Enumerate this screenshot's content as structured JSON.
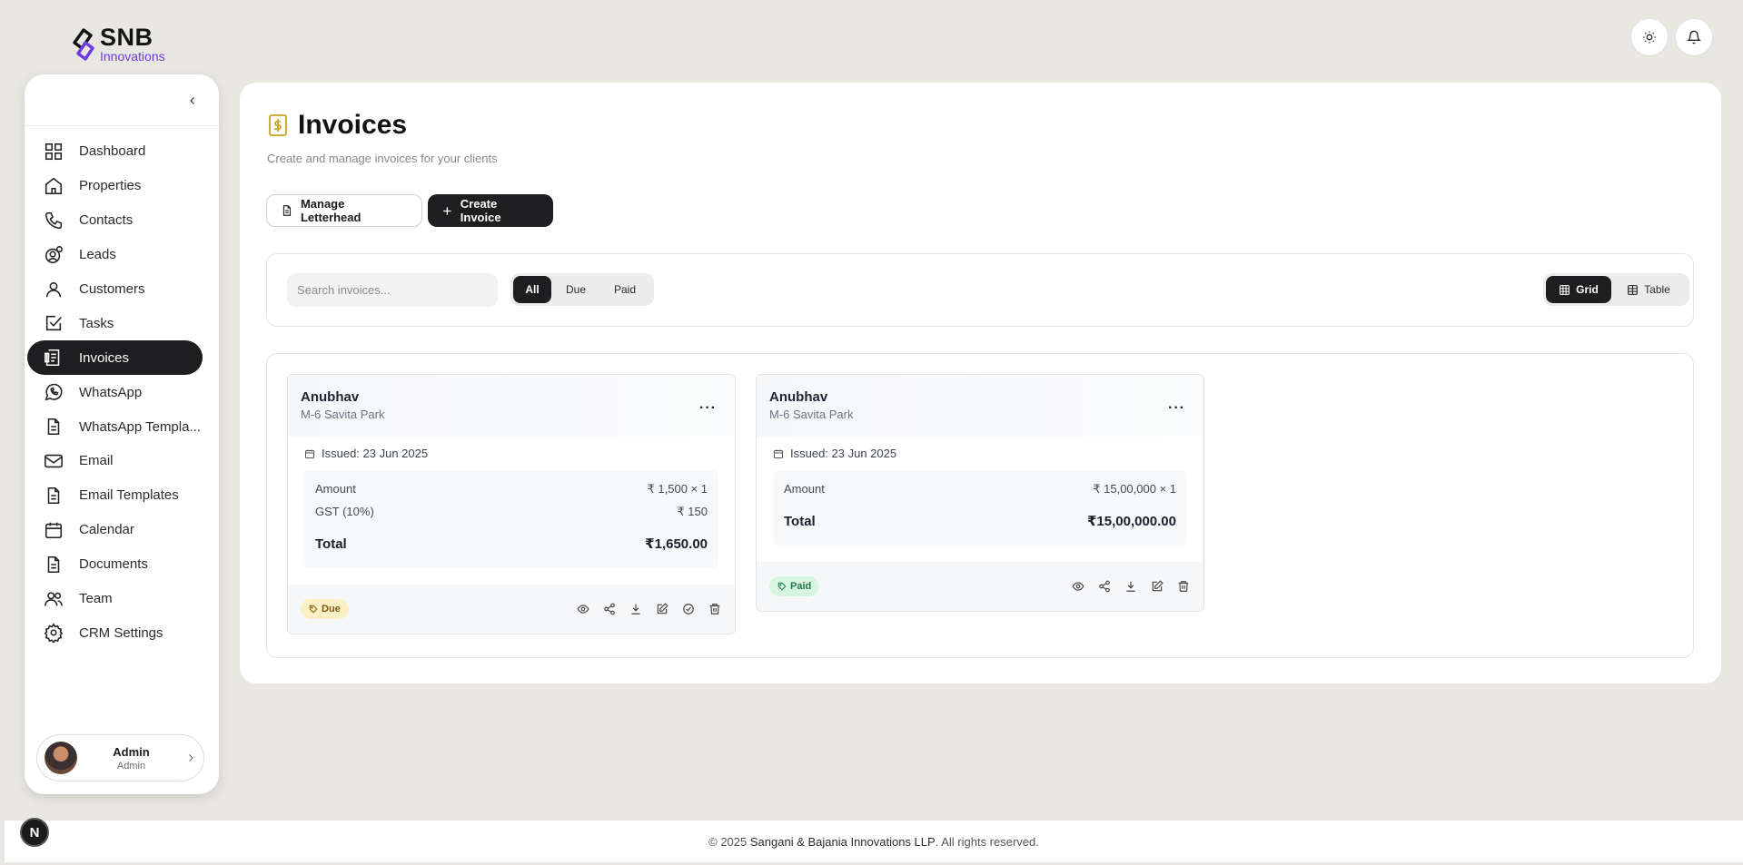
{
  "brand": {
    "name": "SNB",
    "sub": "Innovations"
  },
  "sidebar": {
    "items": [
      {
        "label": "Dashboard",
        "icon": "dashboard-icon"
      },
      {
        "label": "Properties",
        "icon": "home-icon"
      },
      {
        "label": "Contacts",
        "icon": "phone-icon"
      },
      {
        "label": "Leads",
        "icon": "lead-icon"
      },
      {
        "label": "Customers",
        "icon": "user-icon"
      },
      {
        "label": "Tasks",
        "icon": "task-icon"
      },
      {
        "label": "Invoices",
        "icon": "invoice-icon",
        "active": true
      },
      {
        "label": "WhatsApp",
        "icon": "whatsapp-icon"
      },
      {
        "label": "WhatsApp Templa...",
        "icon": "file-icon"
      },
      {
        "label": "Email",
        "icon": "mail-icon"
      },
      {
        "label": "Email Templates",
        "icon": "file-icon"
      },
      {
        "label": "Calendar",
        "icon": "calendar-icon"
      },
      {
        "label": "Documents",
        "icon": "file-icon"
      },
      {
        "label": "Team",
        "icon": "team-icon"
      },
      {
        "label": "CRM Settings",
        "icon": "settings-icon"
      }
    ],
    "user": {
      "name": "Admin",
      "role": "Admin"
    }
  },
  "page": {
    "title": "Invoices",
    "subtitle": "Create and manage invoices for your clients"
  },
  "actions": {
    "letterhead": "Manage Letterhead",
    "create": "Create Invoice"
  },
  "filters": {
    "search_placeholder": "Search invoices...",
    "status": [
      "All",
      "Due",
      "Paid"
    ],
    "views": [
      "Grid",
      "Table"
    ]
  },
  "invoices": [
    {
      "client": "Anubhav",
      "address": "M-6 Savita Park",
      "issued": "Issued: 23 Jun 2025",
      "amount_label": "Amount",
      "amount": "₹ 1,500 × 1",
      "gst_label": "GST (10%)",
      "gst": "₹ 150",
      "total_label": "Total",
      "total": "₹1,650.00",
      "status": "Due"
    },
    {
      "client": "Anubhav",
      "address": "M-6 Savita Park",
      "issued": "Issued: 23 Jun 2025",
      "amount_label": "Amount",
      "amount": "₹ 15,00,000 × 1",
      "total_label": "Total",
      "total": "₹15,00,000.00",
      "status": "Paid"
    }
  ],
  "footer": {
    "prefix": "© 2025 ",
    "company": "Sangani & Bajania Innovations LLP",
    "suffix": ". All rights reserved."
  },
  "dev_badge": "N"
}
